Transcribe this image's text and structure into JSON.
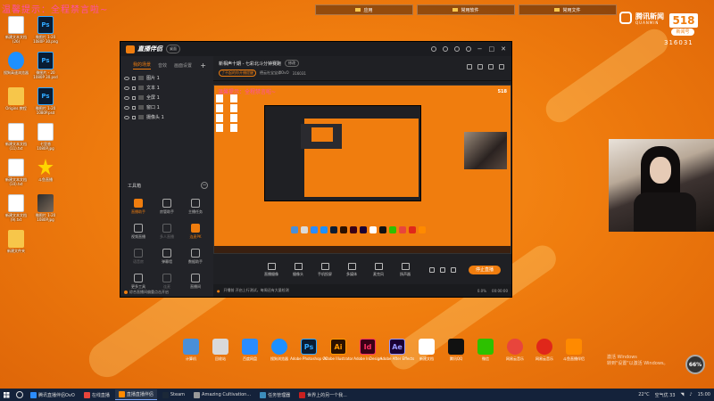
{
  "desktop": {
    "top_text": "温馨提示：全程禁言啦~",
    "folders": [
      {
        "label": "应用"
      },
      {
        "label": "常用软件"
      },
      {
        "label": "常用文件"
      }
    ],
    "icons": [
      {
        "label": "新建文本文档 (26)",
        "icon": "document-icon"
      },
      {
        "label": "微图片 1-20 1080P 30.png",
        "icon": "psd-file-icon"
      },
      {
        "label": "搜狗高速浏览器",
        "icon": "sogou-browser-icon"
      },
      {
        "label": "微图片 - 20 1080P 30.psd",
        "icon": "psd-file-icon"
      },
      {
        "label": "Origins 教程",
        "icon": "folder-icon"
      },
      {
        "label": "微图片 1-20 1080P.psd",
        "icon": "psd-file-icon"
      },
      {
        "label": "新建文本文档 (11).txt",
        "icon": "document-icon"
      },
      {
        "label": "七里香 1080P.jpg",
        "icon": "document-icon"
      },
      {
        "label": "新建文本文档 (10).txt",
        "icon": "document-icon"
      },
      {
        "label": "斗鱼直播",
        "icon": "star-icon"
      },
      {
        "label": "新建文本文档 (9).txt",
        "icon": "document-icon"
      },
      {
        "label": "微图片 1-20 1080P.jpg",
        "icon": "photo-icon"
      },
      {
        "label": "新建文件夹",
        "icon": "folder-icon"
      }
    ]
  },
  "tencent": {
    "brand": "腾讯新闻",
    "brand_en": "QUANMIN",
    "number": "518",
    "tag": "新闻号",
    "id": "316031"
  },
  "app": {
    "name": "直播伴侣",
    "version_tag": "桌面",
    "tabs": [
      "我的场景",
      "音效",
      "画面设置"
    ],
    "scenes": [
      {
        "label": "图片 1"
      },
      {
        "label": "文本 1"
      },
      {
        "label": "全屏 1"
      },
      {
        "label": "窗口 1"
      },
      {
        "label": "摄像头 1"
      }
    ],
    "tools_title": "工具箱",
    "tools": [
      {
        "label": "直播助手",
        "state": "orange"
      },
      {
        "label": "房管助手",
        "state": "normal"
      },
      {
        "label": "主播任务",
        "state": "normal"
      },
      {
        "label": "视频直播",
        "state": "normal"
      },
      {
        "label": "多人直播",
        "state": "dim"
      },
      {
        "label": "连麦PK",
        "state": "orange"
      },
      {
        "label": "语音房",
        "state": "dim"
      },
      {
        "label": "弹幕墙",
        "state": "normal"
      },
      {
        "label": "数据助手",
        "state": "normal"
      },
      {
        "label": "更多工具",
        "state": "normal"
      },
      {
        "label": "连麦",
        "state": "dim"
      },
      {
        "label": "直播间",
        "state": "normal"
      }
    ],
    "footer_notice": "综合直播间偏重点击开启",
    "stream_title": "新相声十期 - 七彩北斗分钟赛跑",
    "edit_label": "修改",
    "warn_label": "了不起的你开播提醒",
    "sub_info": "德云社宝宝谭OvO",
    "sub_id": "316031",
    "bottom_tools": [
      {
        "label": "直播摄像",
        "icon": "screen-icon"
      },
      {
        "label": "摄像头",
        "icon": "camera-icon"
      },
      {
        "label": "手机投屏",
        "icon": "phone-icon"
      },
      {
        "label": "多媒体",
        "icon": "media-icon"
      },
      {
        "label": "麦克风",
        "icon": "mic-icon"
      },
      {
        "label": "扬声器",
        "icon": "speaker-icon"
      }
    ],
    "start_label": "停止直播",
    "status_left": "开播前 开启上行测试，每周还有大量检测",
    "status_right": [
      "0.0%",
      "00:00:00"
    ]
  },
  "dock": [
    {
      "label": "计算机",
      "icon": "computer-icon",
      "color": "#4a8fd8"
    },
    {
      "label": "回收站",
      "icon": "recycle-bin-icon",
      "color": "#d9d9d9"
    },
    {
      "label": "百度网盘",
      "icon": "baidu-netdisk-icon",
      "color": "#2b8cff"
    },
    {
      "label": "搜狗浏览器",
      "icon": "sogou-icon",
      "color": "#1e90ff"
    },
    {
      "label": "Adobe Photoshop CC",
      "icon": "photoshop-icon",
      "color": "#0a1c33"
    },
    {
      "label": "Adobe Illustrator",
      "icon": "illustrator-icon",
      "color": "#2b1000"
    },
    {
      "label": "Adobe InDesign",
      "icon": "indesign-icon",
      "color": "#3b0016"
    },
    {
      "label": "Adobe After Effects",
      "icon": "after-effects-icon",
      "color": "#1a0033"
    },
    {
      "label": "新建文档",
      "icon": "document-icon",
      "color": "#ffffff"
    },
    {
      "label": "腾讯QQ",
      "icon": "qq-icon",
      "color": "#111111"
    },
    {
      "label": "微信",
      "icon": "wechat-icon",
      "color": "#2dc100"
    },
    {
      "label": "网易云音乐",
      "icon": "chrome-icon",
      "color": "#e8453c"
    },
    {
      "label": "网易云音乐",
      "icon": "netease-music-icon",
      "color": "#e0271a"
    },
    {
      "label": "斗鱼直播伴侣",
      "icon": "douyu-icon",
      "color": "#ff8a00"
    }
  ],
  "activate": {
    "line1": "激活 Windows",
    "line2": "转到\"设置\"以激活 Windows。"
  },
  "badge": "66%",
  "taskbar": {
    "items": [
      {
        "label": "腾讯直播伴侣OvO",
        "color": "#2b8cff",
        "active": false
      },
      {
        "label": "在线直播",
        "color": "#e8453c",
        "active": false
      },
      {
        "label": "直播直播伴侣",
        "color": "#ff8a00",
        "active": true
      },
      {
        "label": "Steam",
        "color": "#1b2838",
        "active": false
      },
      {
        "label": "Amazing Cultivation...",
        "color": "#999999",
        "active": false
      },
      {
        "label": "任务管理器",
        "color": "#3c8dbc",
        "active": false
      },
      {
        "label": "世界上的另一个我...",
        "color": "#c82020",
        "active": false
      }
    ],
    "tray": {
      "temp": "22°C",
      "air": "空气优 33",
      "time": "15:00"
    }
  }
}
